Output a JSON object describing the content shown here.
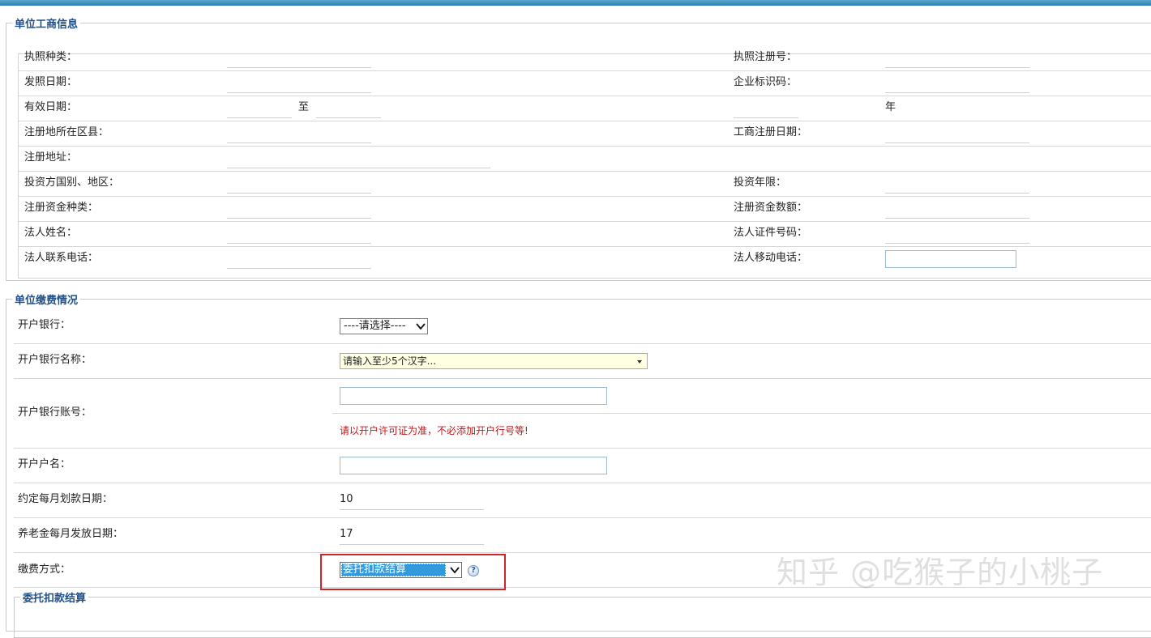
{
  "business_info": {
    "legend": "单位工商信息",
    "labels": {
      "license_type": "执照种类：",
      "license_no": "执照注册号：",
      "issue_date": "发照日期：",
      "enterprise_code": "企业标识码：",
      "valid_date": "有效日期：",
      "to": "至",
      "year_unit": "年",
      "reg_district": "注册地所在区县：",
      "reg_date": "工商注册日期：",
      "reg_address": "注册地址：",
      "investor_region": "投资方国别、地区：",
      "invest_years": "投资年限：",
      "capital_type": "注册资金种类：",
      "capital_amount": "注册资金数额：",
      "legal_name": "法人姓名：",
      "legal_id": "法人证件号码：",
      "legal_phone": "法人联系电话：",
      "legal_mobile": "法人移动电话："
    }
  },
  "payment": {
    "legend": "单位缴费情况",
    "bank_label": "开户银行：",
    "bank_select": "----请选择----",
    "bank_name_label": "开户银行名称：",
    "bank_name_placeholder": "请输入至少5个汉字...",
    "account_label": "开户银行账号：",
    "account_warning": "请以开户许可证为准，不必添加开户行号等!",
    "holder_label": "开户户名：",
    "deduct_day_label": "约定每月划款日期：",
    "deduct_day": "10",
    "pension_day_label": "养老金每月发放日期：",
    "pension_day": "17",
    "method_label": "缴费方式：",
    "method_value": "委托扣款结算",
    "help_glyph": "?"
  },
  "entrust": {
    "legend": "委托扣款结算"
  },
  "watermark": "知乎 @吃猴子的小桃子",
  "colors": {
    "topbar": "#2d7fb0",
    "legend": "#1f4f86",
    "warning": "#c01616",
    "highlight": "#d2222a",
    "selected": "#3399dd"
  }
}
